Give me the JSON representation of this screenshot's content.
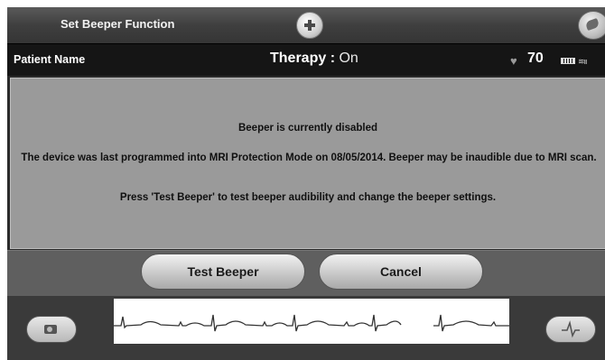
{
  "header": {
    "title": "Set Beeper Function"
  },
  "status": {
    "patient_label": "Patient Name",
    "therapy_label": "Therapy : ",
    "therapy_value": "On",
    "heart_rate": "70"
  },
  "message": {
    "line1": "Beeper is currently disabled",
    "line2": "The device was last programmed into MRI Protection Mode on 08/05/2014. Beeper may be inaudible due to MRI scan.",
    "line3": "Press 'Test Beeper' to test beeper audibility and change the beeper settings."
  },
  "buttons": {
    "test_beeper": "Test Beeper",
    "cancel": "Cancel"
  },
  "icons": {
    "title_center": "plus-icon",
    "title_right": "wand-icon",
    "heart": "heart-icon",
    "battery": "battery-icon",
    "signal": "signal-icon",
    "capture": "camera-icon",
    "event": "ecg-marker-icon"
  }
}
